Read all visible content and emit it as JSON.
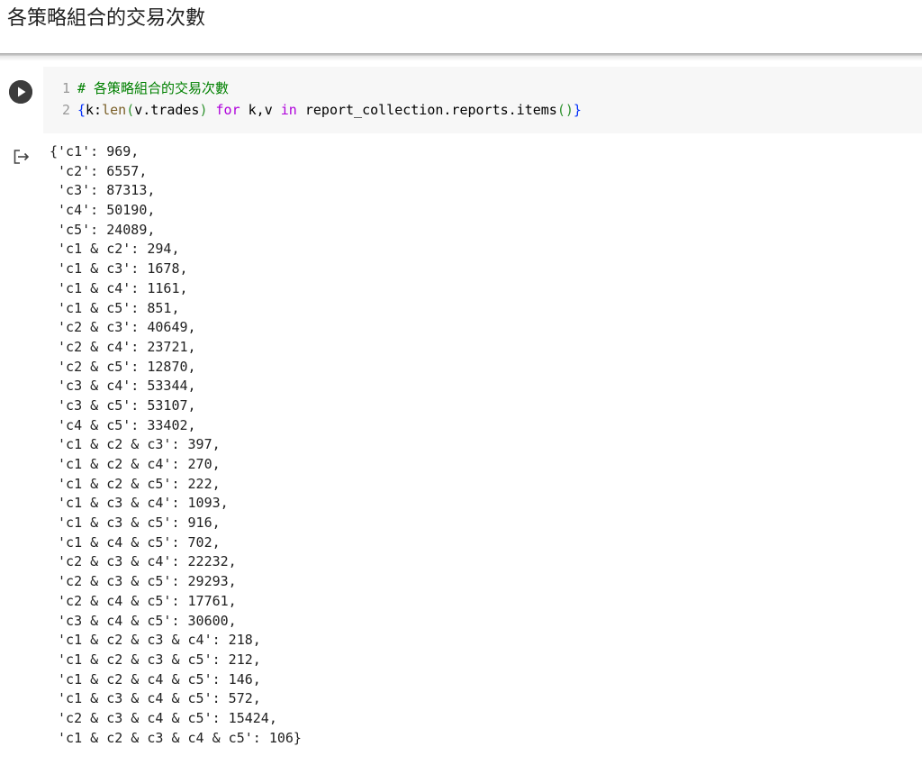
{
  "header": {
    "title": "各策略組合的交易次數"
  },
  "icons": {
    "run": "play-circle-icon",
    "output": "output-arrow-icon"
  },
  "colors": {
    "comment": "#008000",
    "keyword": "#af00db",
    "builtin": "#795e26",
    "bracket": "#0431fa",
    "paren": "#319331",
    "run_button": "#3c3c3c",
    "editor_background": "#f7f7f7"
  },
  "code_cell": {
    "lines": [
      {
        "number": "1",
        "comment": "# 各策略組合的交易次數"
      },
      {
        "number": "2",
        "open_brace": "{",
        "key_var": "k:",
        "builtin": "len",
        "open_paren": "(",
        "arg": "v.trades",
        "close_paren": ")",
        "space1": " ",
        "kw_for": "for",
        "loop_vars": " k,v ",
        "kw_in": "in",
        "iterable": " report_collection.reports.items",
        "call_parens": "()",
        "close_brace": "}"
      }
    ]
  },
  "output": {
    "lines": [
      "{'c1': 969,",
      " 'c2': 6557,",
      " 'c3': 87313,",
      " 'c4': 50190,",
      " 'c5': 24089,",
      " 'c1 & c2': 294,",
      " 'c1 & c3': 1678,",
      " 'c1 & c4': 1161,",
      " 'c1 & c5': 851,",
      " 'c2 & c3': 40649,",
      " 'c2 & c4': 23721,",
      " 'c2 & c5': 12870,",
      " 'c3 & c4': 53344,",
      " 'c3 & c5': 53107,",
      " 'c4 & c5': 33402,",
      " 'c1 & c2 & c3': 397,",
      " 'c1 & c2 & c4': 270,",
      " 'c1 & c2 & c5': 222,",
      " 'c1 & c3 & c4': 1093,",
      " 'c1 & c3 & c5': 916,",
      " 'c1 & c4 & c5': 702,",
      " 'c2 & c3 & c4': 22232,",
      " 'c2 & c3 & c5': 29293,",
      " 'c2 & c4 & c5': 17761,",
      " 'c3 & c4 & c5': 30600,",
      " 'c1 & c2 & c3 & c4': 218,",
      " 'c1 & c2 & c3 & c5': 212,",
      " 'c1 & c2 & c4 & c5': 146,",
      " 'c1 & c3 & c4 & c5': 572,",
      " 'c2 & c3 & c4 & c5': 15424,",
      " 'c1 & c2 & c3 & c4 & c5': 106}"
    ]
  }
}
